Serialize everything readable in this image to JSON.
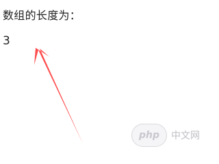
{
  "content": {
    "label_text": "数组的长度为：",
    "value_text": "3"
  },
  "annotation": {
    "arrow_color": "#ff4b4b"
  },
  "watermark": {
    "brand_text": "php",
    "site_text": "中文网"
  }
}
